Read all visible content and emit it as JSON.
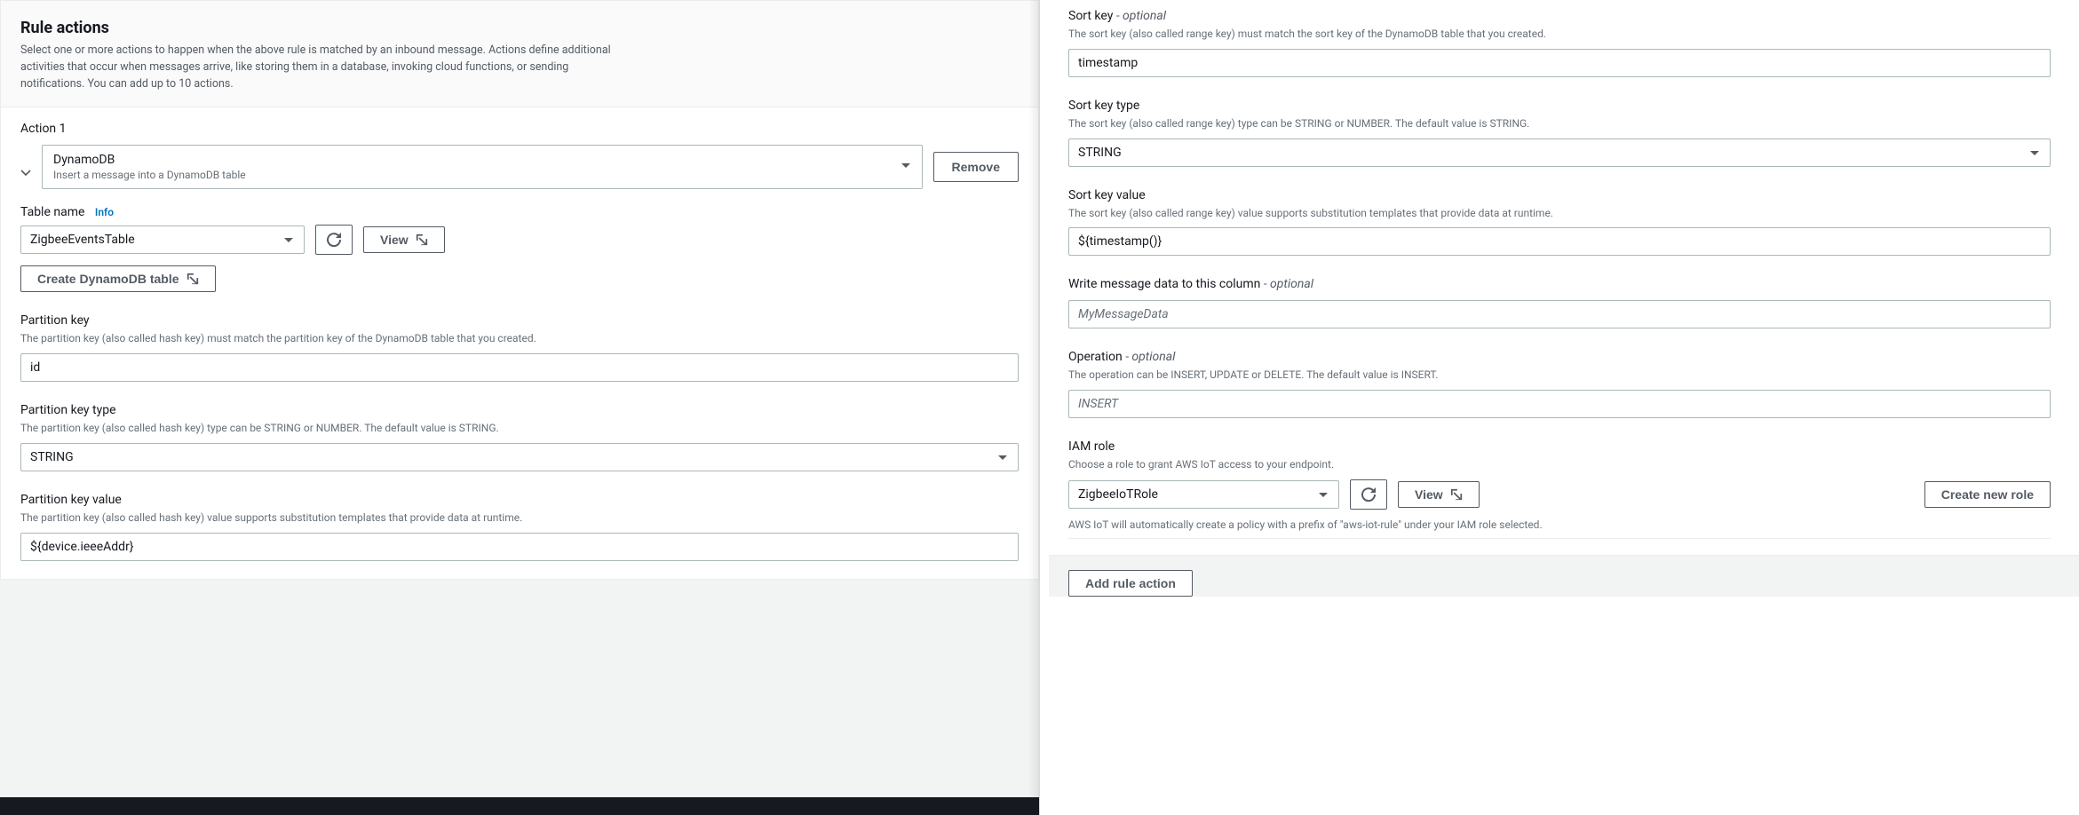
{
  "header": {
    "title": "Rule actions",
    "desc": "Select one or more actions to happen when the above rule is matched by an inbound message. Actions define additional activities that occur when messages arrive, like storing them in a database, invoking cloud functions, or sending notifications. You can add up to 10 actions."
  },
  "action": {
    "heading": "Action 1",
    "type_primary": "DynamoDB",
    "type_secondary": "Insert a message into a DynamoDB table",
    "remove_label": "Remove"
  },
  "table": {
    "label": "Table name",
    "info": "Info",
    "value": "ZigbeeEventsTable",
    "view_label": "View",
    "create_label": "Create DynamoDB table"
  },
  "pk": {
    "label": "Partition key",
    "help": "The partition key (also called hash key) must match the partition key of the DynamoDB table that you created.",
    "value": "id"
  },
  "pkt": {
    "label": "Partition key type",
    "help": "The partition key (also called hash key) type can be STRING or NUMBER. The default value is STRING.",
    "value": "STRING"
  },
  "pkv": {
    "label": "Partition key value",
    "help": "The partition key (also called hash key) value supports substitution templates that provide data at runtime.",
    "value": "${device.ieeeAddr}"
  },
  "sk": {
    "label": "Sort key",
    "optional": "- optional",
    "help": "The sort key (also called range key) must match the sort key of the DynamoDB table that you created.",
    "value": "timestamp"
  },
  "skt": {
    "label": "Sort key type",
    "help": "The sort key (also called range key) type can be STRING or NUMBER. The default value is STRING.",
    "value": "STRING"
  },
  "skv": {
    "label": "Sort key value",
    "help": "The sort key (also called range key) value supports substitution templates that provide data at runtime.",
    "value": "${timestamp()}"
  },
  "msgcol": {
    "label": "Write message data to this column",
    "optional": "- optional",
    "placeholder": "MyMessageData"
  },
  "op": {
    "label": "Operation",
    "optional": "- optional",
    "help": "The operation can be INSERT, UPDATE or DELETE. The default value is INSERT.",
    "placeholder": "INSERT"
  },
  "iam": {
    "label": "IAM role",
    "help": "Choose a role to grant AWS IoT access to your endpoint.",
    "value": "ZigbeeIoTRole",
    "view_label": "View",
    "create_label": "Create new role",
    "note": "AWS IoT will automatically create a policy with a prefix of \"aws-iot-rule\" under your IAM role selected."
  },
  "footer": {
    "add_label": "Add rule action"
  }
}
